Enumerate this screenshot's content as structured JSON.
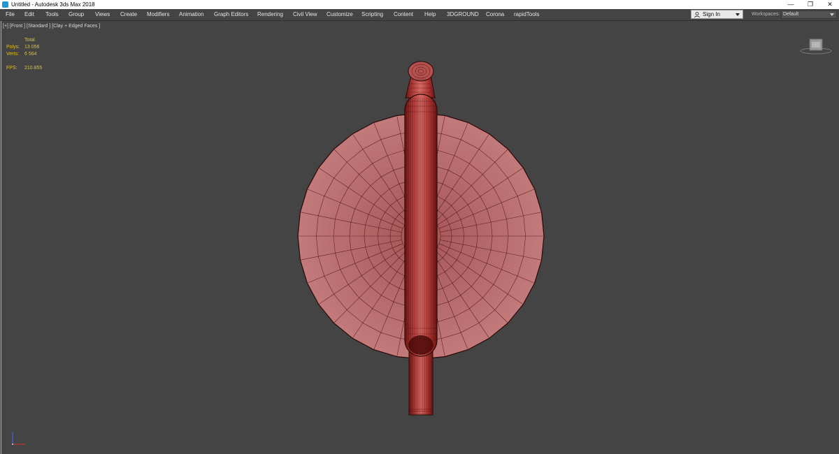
{
  "window": {
    "title": "Untitled - Autodesk 3ds Max 2018",
    "controls": [
      "—",
      "❐",
      "✕"
    ]
  },
  "menu": {
    "items": [
      "File",
      "Edit",
      "Tools",
      "Group",
      "Views",
      "Create",
      "Modifiers",
      "Animation",
      "Graph Editors",
      "Rendering",
      "Civil View",
      "Customize",
      "Scripting",
      "Content",
      "Help",
      "3DGROUND",
      "Corona",
      "rapidTools"
    ]
  },
  "account": {
    "signin_label": "Sign In"
  },
  "workspaces": {
    "label": "Workspaces:",
    "value": "Default"
  },
  "viewport": {
    "label": "[+] [Front ] [Standard ] [Clay + Edged Faces ]",
    "stats": {
      "header": "Total",
      "polys_label": "Polys:",
      "polys_value": "13 056",
      "verts_label": "Verts:",
      "verts_value": "6 564",
      "fps_label": "FPS:",
      "fps_value": "210.855"
    }
  },
  "colors": {
    "viewport_bg": "#444444",
    "stats_text": "#e3c21a",
    "active_border": "#e8b400",
    "model_fill": "#b4696b",
    "model_edge": "#4a0e0e",
    "handle_fill": "#b83a36"
  },
  "icons": [
    "app-icon",
    "user-icon",
    "viewcube-icon",
    "axis-gizmo-icon"
  ]
}
